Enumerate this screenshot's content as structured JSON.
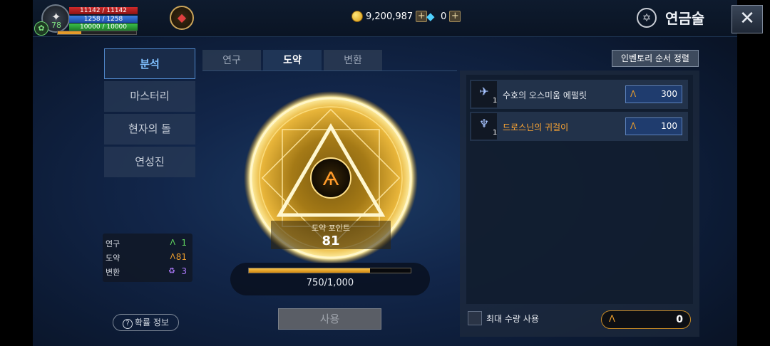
{
  "header": {
    "hp": "11142 / 11142",
    "mp": "1258 / 1258",
    "sp": "10000 / 10000",
    "level": "78",
    "gold": "9,200,987",
    "diamond": "0",
    "plus": "+",
    "title": "연금술",
    "close": "✕"
  },
  "menu": {
    "items": [
      {
        "label": "분석"
      },
      {
        "label": "마스터리"
      },
      {
        "label": "현자의 돌"
      },
      {
        "label": "연성진"
      }
    ]
  },
  "tabs": [
    {
      "label": "연구"
    },
    {
      "label": "도약"
    },
    {
      "label": "변환"
    }
  ],
  "points": {
    "rows": [
      {
        "label": "연구",
        "value": "1",
        "color": "#5fd35f"
      },
      {
        "label": "도약",
        "value": "81",
        "color": "#e89a2c"
      },
      {
        "label": "변환",
        "value": "3",
        "color": "#b07cff"
      }
    ]
  },
  "probability_button": "확률 정보",
  "circle": {
    "point_label": "도약 포인트",
    "point_value": "81"
  },
  "progress": {
    "current": 750,
    "max": 1000,
    "text": "750/1,000"
  },
  "use_button": "사용",
  "sort_button": "인벤토리 순서 정렬",
  "inventory": [
    {
      "name": "수호의 오스미움 에펄릿",
      "qty": "1",
      "value": "300",
      "name_color": "normal"
    },
    {
      "name": "드로스닌의 귀걸이",
      "qty": "1",
      "value": "100",
      "name_color": "orange"
    }
  ],
  "max_use_label": "최대 수량 사용",
  "total_value": "0",
  "colors": {
    "accent_blue": "#4f86c8",
    "leap_orange": "#e59a2c",
    "gold_glow": "#ffd35a"
  }
}
